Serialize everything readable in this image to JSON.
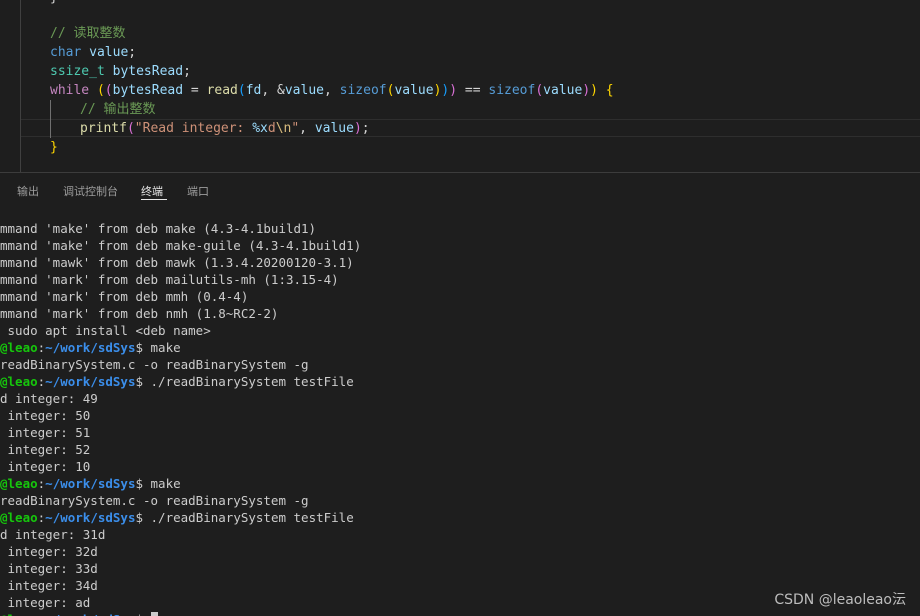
{
  "editor": {
    "top_fragment": "}",
    "line1_comment": "// 读取整数",
    "line2_type": "char",
    "line2_var": "value",
    "line2_end": ";",
    "line3_type": "ssize_t",
    "line3_var": "bytesRead",
    "line3_end": ";",
    "line4": {
      "kw_while": "while",
      "p1": "(",
      "p2": "(",
      "var_bytesread": "bytesRead",
      "eq": " = ",
      "fn_read": "read",
      "p3": "(",
      "arg_fd": "fd",
      "comma1": ", ",
      "amp": "&",
      "arg_value": "value",
      "comma2": ", ",
      "kw_sizeof": "sizeof",
      "p4": "(",
      "arg_value2": "value",
      "p5": ")",
      "p6": ")",
      "p7": ")",
      "cmp": " == ",
      "kw_sizeof2": "sizeof",
      "p8": "(",
      "arg_value3": "value",
      "p9": ")",
      "p10": ")",
      "brace_open": " {"
    },
    "line5_comment": "// 输出整数",
    "line6": {
      "fn_printf": "printf",
      "p1": "(",
      "str1": "\"Read integer: ",
      "fmt": "%x",
      "str2": "d",
      "esc": "\\n",
      "str3": "\"",
      "comma": ", ",
      "arg_value": "value",
      "p2": ")",
      "semi": ";"
    },
    "line7_brace": "}"
  },
  "panel": {
    "tabs": [
      "输出",
      "调试控制台",
      "终端",
      "端口"
    ],
    "active_tab": "终端"
  },
  "terminal": {
    "lines": [
      {
        "type": "text",
        "text": "mmand 'make' from deb make (4.3-4.1build1)"
      },
      {
        "type": "text",
        "text": "mmand 'make' from deb make-guile (4.3-4.1build1)"
      },
      {
        "type": "text",
        "text": "mmand 'mawk' from deb mawk (1.3.4.20200120-3.1)"
      },
      {
        "type": "text",
        "text": "mmand 'mark' from deb mailutils-mh (1:3.15-4)"
      },
      {
        "type": "text",
        "text": "mmand 'mark' from deb mmh (0.4-4)"
      },
      {
        "type": "text",
        "text": "mmand 'mark' from deb nmh (1.8~RC2-2)"
      },
      {
        "type": "text",
        "text": " sudo apt install <deb name>"
      },
      {
        "type": "prompt",
        "user": "@leao",
        "sep": ":",
        "path": "~/work/sdSys",
        "cmd": "$ make"
      },
      {
        "type": "text",
        "text": "readBinarySystem.c -o readBinarySystem -g"
      },
      {
        "type": "prompt",
        "user": "@leao",
        "sep": ":",
        "path": "~/work/sdSys",
        "cmd": "$ ./readBinarySystem testFile"
      },
      {
        "type": "text",
        "text": "d integer: 49"
      },
      {
        "type": "text",
        "text": " integer: 50"
      },
      {
        "type": "text",
        "text": " integer: 51"
      },
      {
        "type": "text",
        "text": " integer: 52"
      },
      {
        "type": "text",
        "text": " integer: 10"
      },
      {
        "type": "prompt",
        "user": "@leao",
        "sep": ":",
        "path": "~/work/sdSys",
        "cmd": "$ make"
      },
      {
        "type": "text",
        "text": "readBinarySystem.c -o readBinarySystem -g"
      },
      {
        "type": "prompt",
        "user": "@leao",
        "sep": ":",
        "path": "~/work/sdSys",
        "cmd": "$ ./readBinarySystem testFile"
      },
      {
        "type": "text",
        "text": "d integer: 31d"
      },
      {
        "type": "text",
        "text": " integer: 32d"
      },
      {
        "type": "text",
        "text": " integer: 33d"
      },
      {
        "type": "text",
        "text": " integer: 34d"
      },
      {
        "type": "text",
        "text": " integer: ad"
      },
      {
        "type": "prompt-cursor",
        "user": "@leao",
        "sep": ":",
        "path": "~/work/sdSys",
        "cmd": "$ "
      }
    ]
  },
  "watermark": "CSDN @leaoleao沄"
}
